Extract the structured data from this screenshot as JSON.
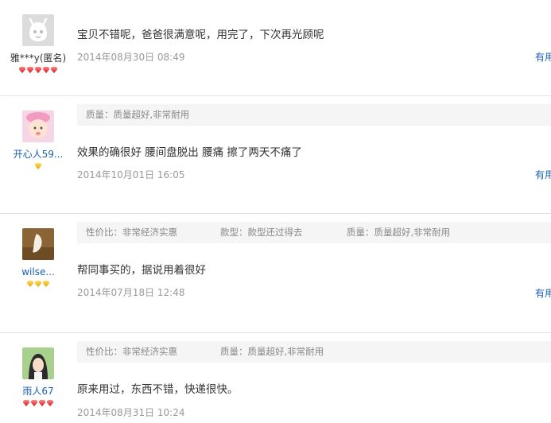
{
  "reviews": [
    {
      "username": "雅***y(匿名)",
      "badges": [
        "red",
        "red",
        "red",
        "red",
        "red"
      ],
      "tags": [],
      "content": "宝贝不错呢，爸爸很满意呢，用完了，下次再光顾呢",
      "date": "2014年08月30日 08:49",
      "useful": "有用"
    },
    {
      "username": "开心人59...",
      "badges": [
        "yellow"
      ],
      "tags": [
        "质量：质量超好,非常耐用"
      ],
      "content": "效果的确很好 腰间盘脱出 腰痛 擦了两天不痛了",
      "date": "2014年10月01日 16:05",
      "useful": "有用"
    },
    {
      "username": "wilse...",
      "badges": [
        "yellow",
        "yellow",
        "yellow"
      ],
      "tags": [
        "性价比：非常经济实惠",
        "款型：款型还过得去",
        "质量：质量超好,非常耐用"
      ],
      "content": "帮同事买的，据说用着很好",
      "date": "2014年07月18日 12:48",
      "useful": "有用"
    },
    {
      "username": "雨人67",
      "badges": [
        "red",
        "red",
        "red",
        "red"
      ],
      "tags": [
        "性价比：非常经济实惠",
        "质量：质量超好,非常耐用"
      ],
      "content": "原来用过，东西不错，快递很快。",
      "date": "2014年08月31日 10:24",
      "useful": ""
    }
  ]
}
